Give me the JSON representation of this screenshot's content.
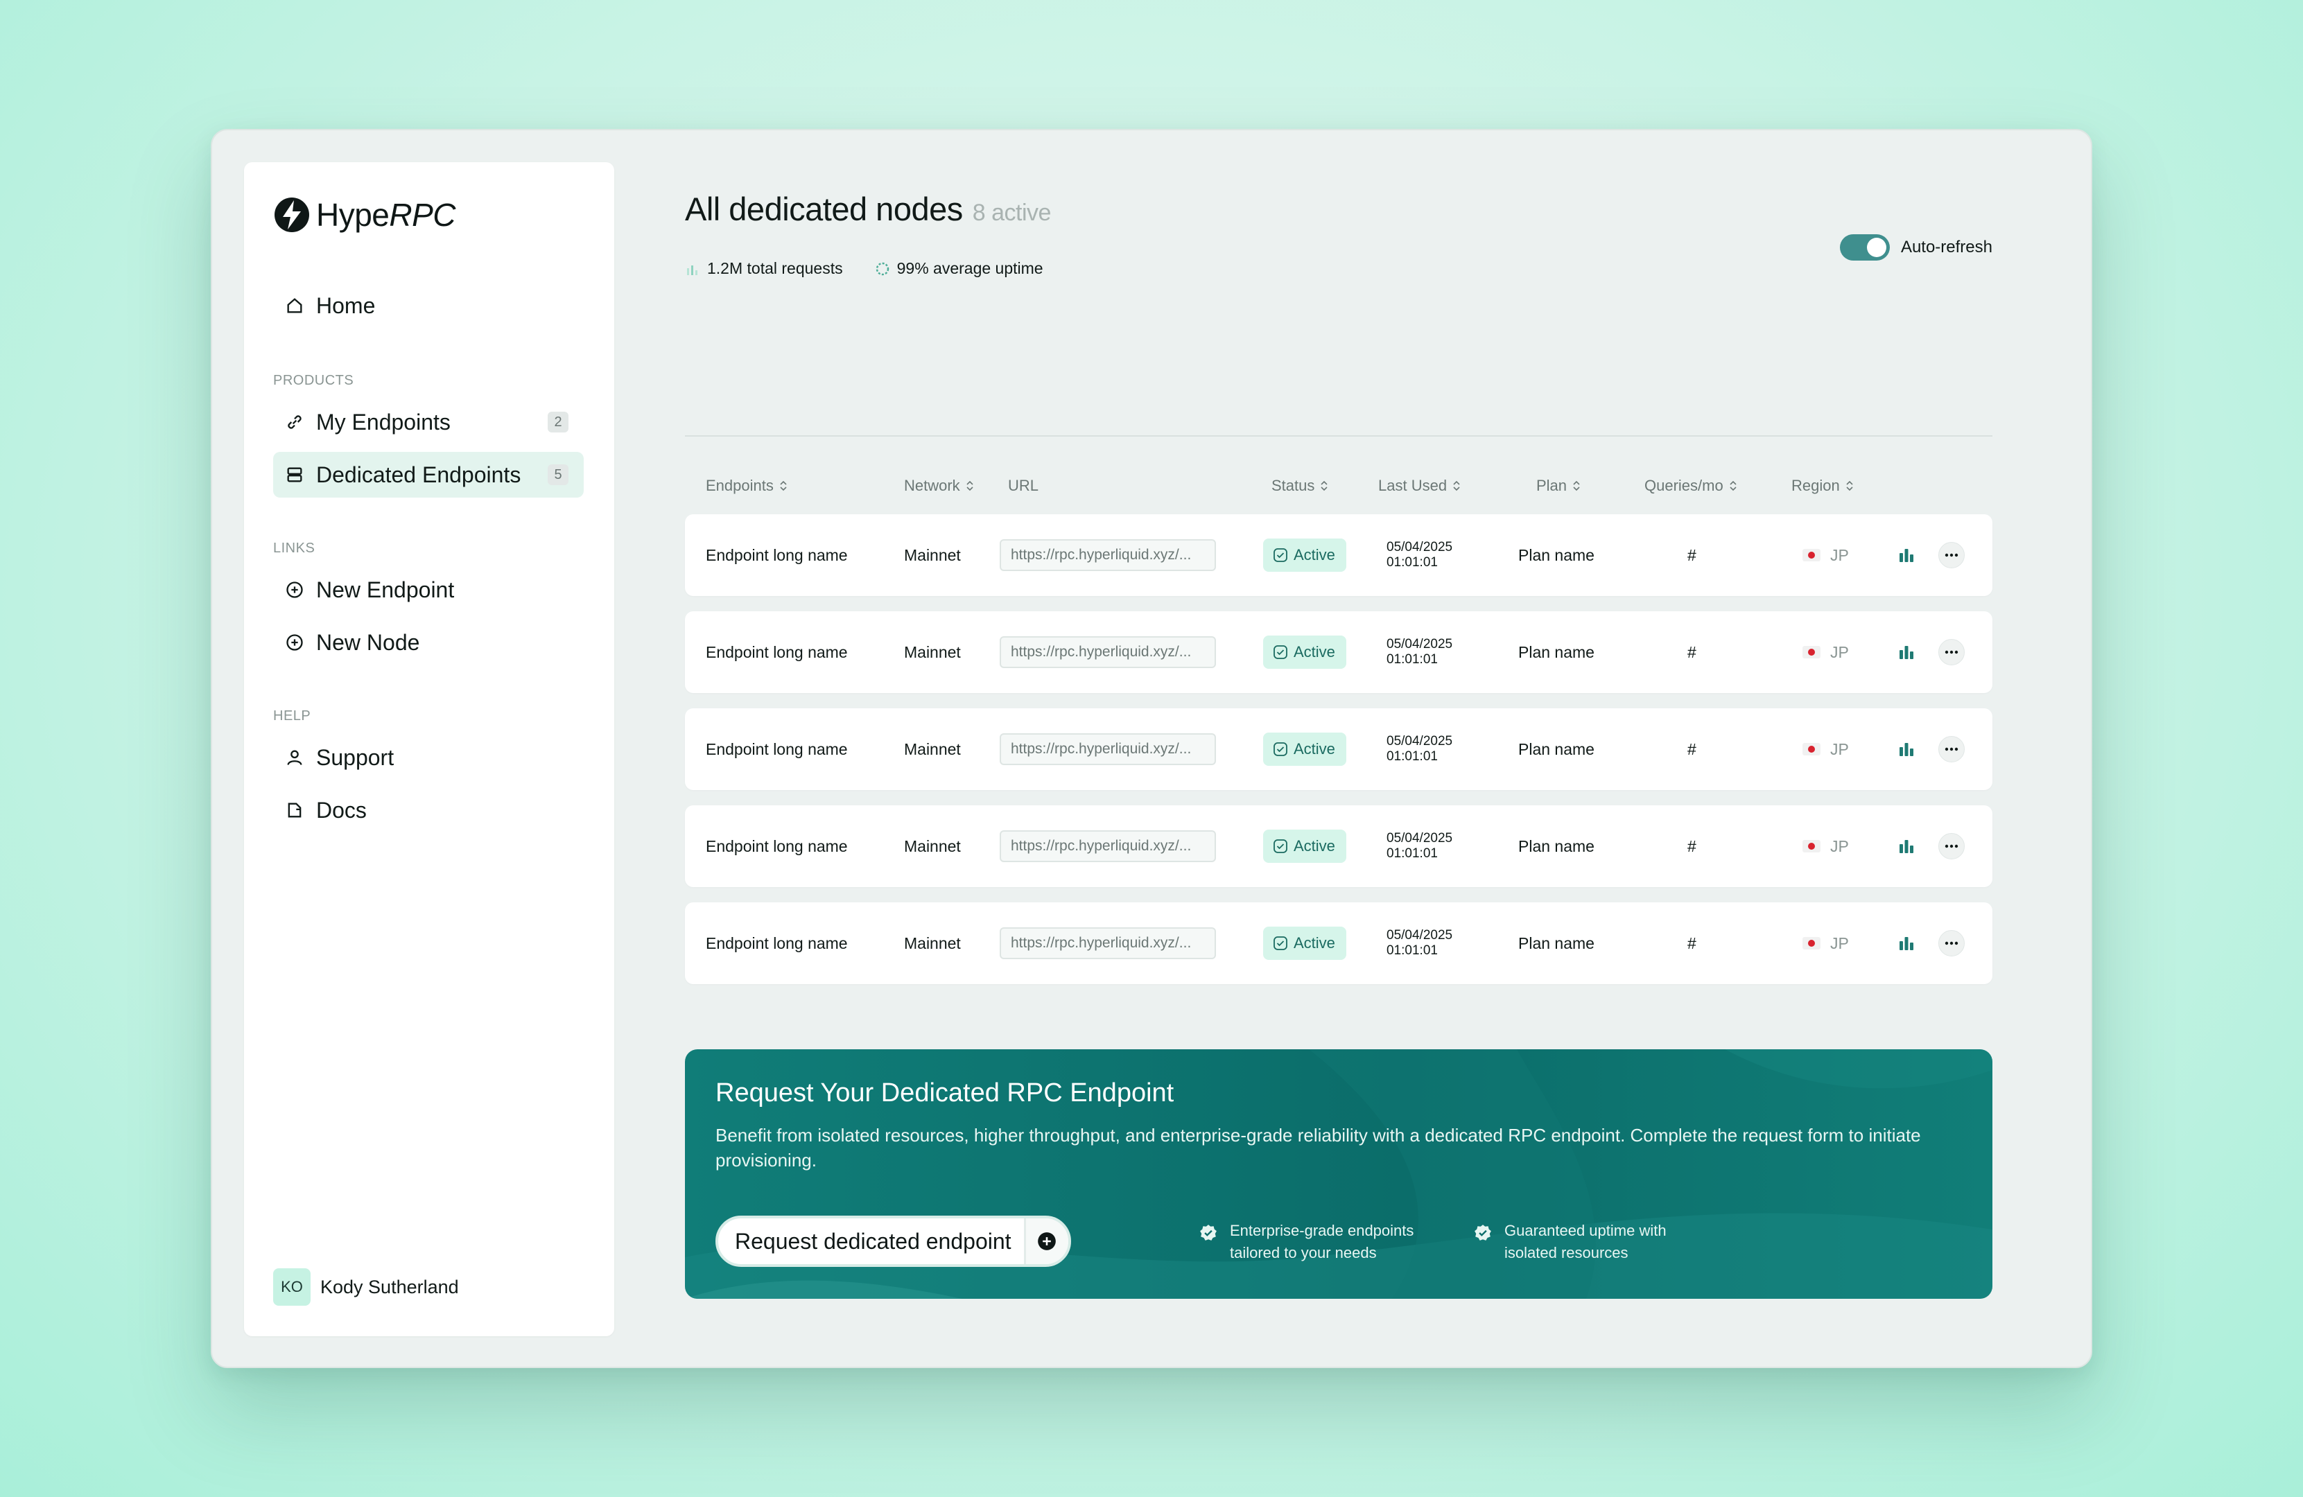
{
  "brand": {
    "name_regular": "Hype",
    "name_italic": "RPC"
  },
  "sidebar": {
    "home": {
      "label": "Home"
    },
    "products_label": "PRODUCTS",
    "products": [
      {
        "label": "My Endpoints",
        "count": "2",
        "icon": "link-icon"
      },
      {
        "label": "Dedicated Endpoints",
        "count": "5",
        "icon": "server-icon",
        "active": true
      }
    ],
    "links_label": "LINKS",
    "links": [
      {
        "label": "New Endpoint",
        "icon": "plus-circle-icon"
      },
      {
        "label": "New Node",
        "icon": "plus-circle-icon"
      }
    ],
    "help_label": "HELP",
    "help": [
      {
        "label": "Support",
        "icon": "user-icon"
      },
      {
        "label": "Docs",
        "icon": "doc-icon"
      }
    ],
    "user": {
      "initials": "KO",
      "name": "Kody Sutherland"
    }
  },
  "header": {
    "title": "All dedicated nodes",
    "subtitle": "8 active",
    "stats": {
      "requests": "1.2M total requests",
      "uptime": "99% average uptime"
    },
    "auto_refresh": {
      "label": "Auto-refresh",
      "on": true
    }
  },
  "table": {
    "columns": [
      "Endpoints",
      "Network",
      "URL",
      "Status",
      "Last Used",
      "Plan",
      "Queries/mo",
      "Region"
    ],
    "rows": [
      {
        "endpoint": "Endpoint long name",
        "network": "Mainnet",
        "url": "https://rpc.hyperliquid.xyz/...",
        "status": "Active",
        "date": "05/04/2025",
        "time": "01:01:01",
        "plan": "Plan name",
        "queries": "#",
        "region": "JP"
      },
      {
        "endpoint": "Endpoint long name",
        "network": "Mainnet",
        "url": "https://rpc.hyperliquid.xyz/...",
        "status": "Active",
        "date": "05/04/2025",
        "time": "01:01:01",
        "plan": "Plan name",
        "queries": "#",
        "region": "JP"
      },
      {
        "endpoint": "Endpoint long name",
        "network": "Mainnet",
        "url": "https://rpc.hyperliquid.xyz/...",
        "status": "Active",
        "date": "05/04/2025",
        "time": "01:01:01",
        "plan": "Plan name",
        "queries": "#",
        "region": "JP"
      },
      {
        "endpoint": "Endpoint long name",
        "network": "Mainnet",
        "url": "https://rpc.hyperliquid.xyz/...",
        "status": "Active",
        "date": "05/04/2025",
        "time": "01:01:01",
        "plan": "Plan name",
        "queries": "#",
        "region": "JP"
      },
      {
        "endpoint": "Endpoint long name",
        "network": "Mainnet",
        "url": "https://rpc.hyperliquid.xyz/...",
        "status": "Active",
        "date": "05/04/2025",
        "time": "01:01:01",
        "plan": "Plan name",
        "queries": "#",
        "region": "JP"
      }
    ]
  },
  "banner": {
    "title": "Request Your Dedicated RPC Endpoint",
    "description": "Benefit from isolated resources, higher throughput, and enterprise-grade reliability with a dedicated RPC endpoint. Complete the request form to initiate provisioning.",
    "button_label": "Request dedicated endpoint",
    "features": [
      {
        "line1": "Enterprise-grade endpoints",
        "line2": "tailored to your needs"
      },
      {
        "line1": "Guaranteed uptime with",
        "line2": "isolated resources"
      }
    ]
  },
  "colors": {
    "accent": "#0b6d6a",
    "active_bg": "#d6f5ea",
    "active_text": "#1a6a60",
    "flag_red": "#d8232f"
  }
}
